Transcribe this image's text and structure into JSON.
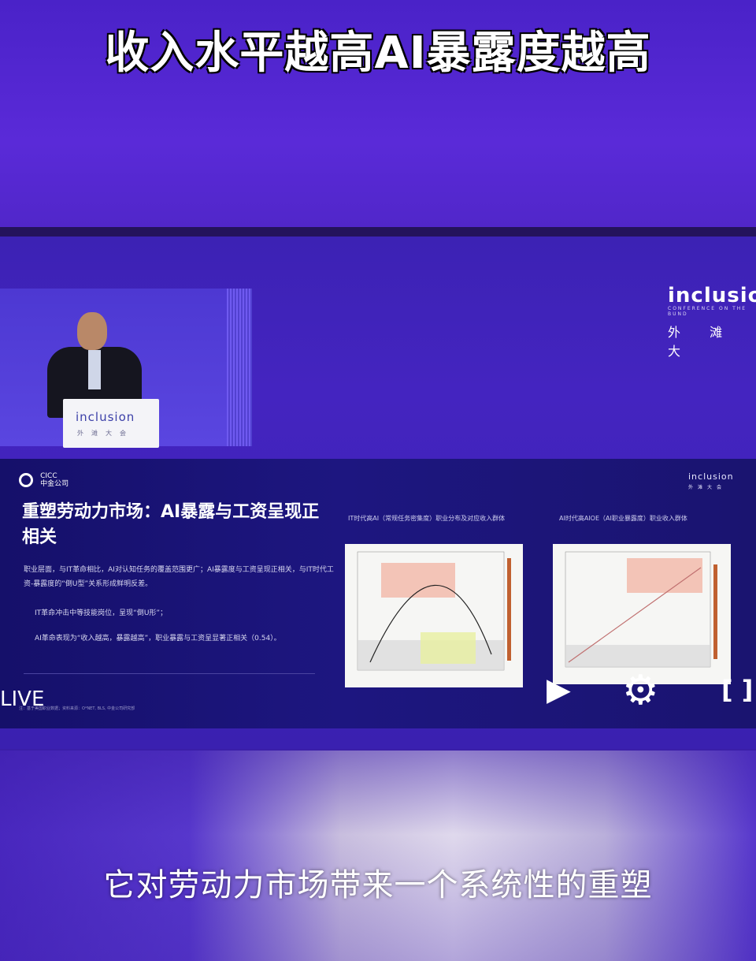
{
  "header": {
    "title": "收入水平越高AI暴露度越高"
  },
  "video": {
    "brand_logo": "inclusion",
    "brand_sub": "CONFERENCE ON THE BUND",
    "brand_cn": "外 滩 大",
    "podium_logo": "inclusion",
    "podium_cn": "外滩大会"
  },
  "slide": {
    "org_logo": "CICC",
    "org_cn": "中金公司",
    "brand_logo": "inclusion",
    "brand_cn": "外滩大会",
    "title": "重塑劳动力市场：AI暴露与工资呈现正相关",
    "bullet_main": "职业层面，与IT革命相比，AI对认知任务的覆盖范围更广；AI暴露度与工资呈现正相关，与IT时代工资-暴露度的“倒U型”关系形成鲜明反差。",
    "bullet_sub1": "IT革命冲击中等技能岗位，呈现“倒U形”；",
    "bullet_sub2": "AI革命表现为“收入越高，暴露越高”，职业暴露与工资呈显著正相关（0.54）。",
    "footnote": "注：基于美国职业数据；资料来源：O*NET, BLS, 中金公司研究部",
    "chart_left_title": "IT时代高AI（常规任务密集度）职业分布及对应收入群体",
    "chart_right_title": "AI时代高AIOE（AI职业暴露度）职业收入群体",
    "live": "LIVE"
  },
  "controls": {
    "play_label": "▶",
    "settings_label": "⚙",
    "fullscreen_label": "[ ]"
  },
  "subtitle": "它对劳动力市场带来一个系统性的重塑"
}
